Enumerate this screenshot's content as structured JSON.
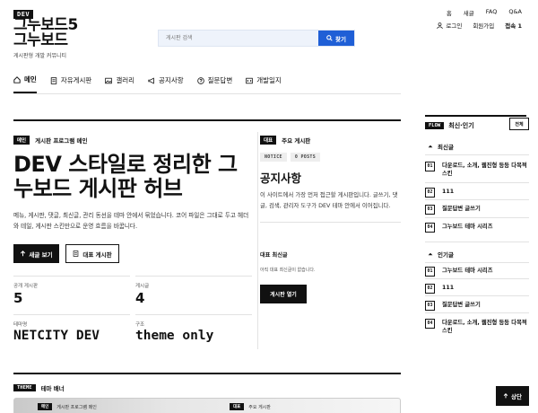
{
  "header": {
    "badge": "DEV",
    "logo_line1": "그누보드5",
    "logo_line2": "그누보드",
    "subtitle": "게시판형 개발 커뮤니티",
    "search_placeholder": "게시판 검색",
    "search_button": "찾기",
    "top_links": [
      "홈",
      "새글",
      "FAQ",
      "Q&A"
    ],
    "login": "로그인",
    "signup": "회원가입",
    "visitors_label": "접속",
    "visitors_count": "1"
  },
  "nav": {
    "items": [
      {
        "label": "메인",
        "icon": "home-icon",
        "active": true
      },
      {
        "label": "자유게시판",
        "icon": "document-icon",
        "active": false
      },
      {
        "label": "갤러리",
        "icon": "image-icon",
        "active": false
      },
      {
        "label": "공지사항",
        "icon": "megaphone-icon",
        "active": false
      },
      {
        "label": "질문답변",
        "icon": "question-icon",
        "active": false
      },
      {
        "label": "개발일지",
        "icon": "code-icon",
        "active": false
      }
    ]
  },
  "hero": {
    "tag": "메인",
    "kicker": "게시판 프로그램 메인",
    "title": "DEV 스타일로 정리한 그누보드 게시판 허브",
    "description": "메뉴, 게시판, 댓글, 최신글, 관리 동선을 테마 안에서 묶었습니다. 코어 파일은 그대로 두고 헤더와 테일, 게시판 스킨만으로 운영 흐름을 바꿉니다.",
    "primary_button": "새글 보기",
    "secondary_button": "대표 게시판",
    "stats": [
      {
        "label": "공개 게시판",
        "value": "5"
      },
      {
        "label": "게시글",
        "value": "4"
      },
      {
        "label": "테마명",
        "value": "NETCITY DEV"
      },
      {
        "label": "구조",
        "value": "theme only"
      }
    ]
  },
  "notice": {
    "tag": "대표",
    "heading": "주요 게시판",
    "tags": [
      "NOTICE",
      "0 POSTS"
    ],
    "title": "공지사항",
    "description": "이 사이트에서 가장 먼저 접근할 게시판입니다. 글쓰기, 댓글, 검색, 관리자 도구가 DEV 테마 안에서 이어집니다.",
    "latest_label": "대표 최신글",
    "empty_text": "아직 대표 최신글이 없습니다.",
    "open_button": "게시판 열기"
  },
  "banner": {
    "tag": "THEME",
    "heading": "테마 배너",
    "inner_left_tag": "메인",
    "inner_left_text": "게시판 프로그램 메인",
    "inner_right_tag": "대표",
    "inner_right_text": "주요 게시판"
  },
  "sidebar": {
    "tag": "FLOW",
    "heading": "최신·인기",
    "all_button": "전체",
    "recent_heading": "최신글",
    "recent": [
      {
        "rank": "01",
        "title": "다운로드, 소개, 웹진형 등등 다목적 스킨"
      },
      {
        "rank": "02",
        "title": "111"
      },
      {
        "rank": "03",
        "title": "질문답변 글쓰기"
      },
      {
        "rank": "04",
        "title": "그누보드 테마 시리즈"
      }
    ],
    "popular_heading": "인기글",
    "popular": [
      {
        "rank": "01",
        "title": "그누보드 테마 시리즈"
      },
      {
        "rank": "02",
        "title": "111"
      },
      {
        "rank": "03",
        "title": "질문답변 글쓰기"
      },
      {
        "rank": "04",
        "title": "다운로드, 소개, 웹진형 등등 다목적 스킨"
      }
    ],
    "top_button": "상단"
  }
}
